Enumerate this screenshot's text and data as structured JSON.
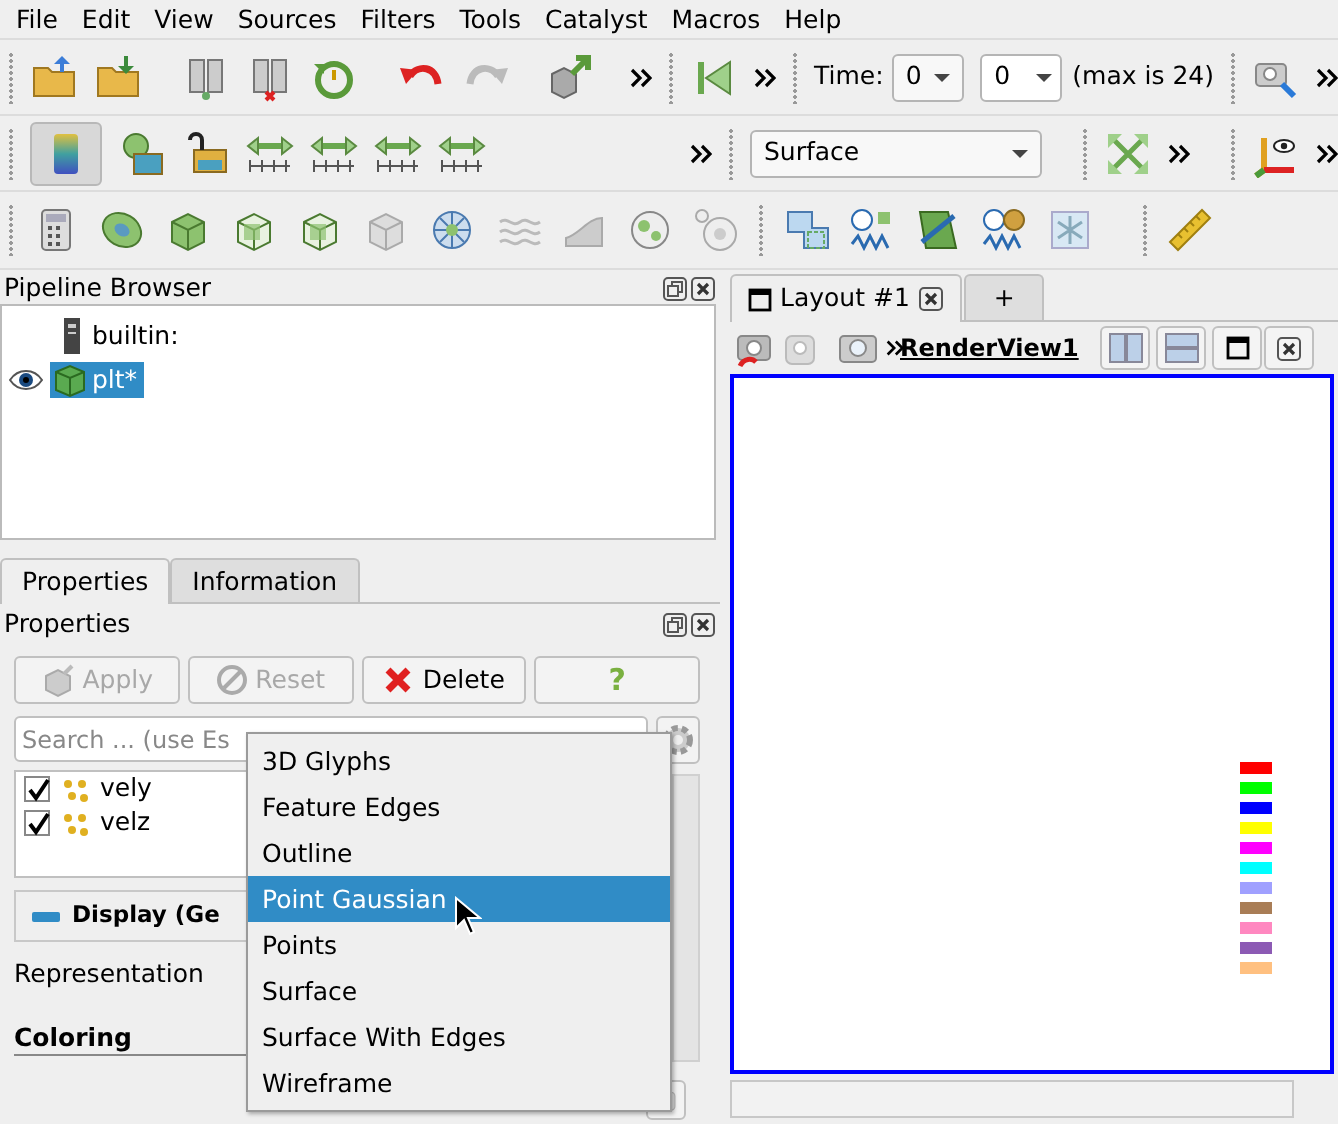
{
  "menu": [
    "File",
    "Edit",
    "View",
    "Sources",
    "Filters",
    "Tools",
    "Catalyst",
    "Macros",
    "Help"
  ],
  "time_toolbar": {
    "label": "Time:",
    "time_select": "0",
    "time_index": "0",
    "max_note": "(max is 24)"
  },
  "representation_select": "Surface",
  "pipeline_browser": {
    "title": "Pipeline Browser",
    "items": [
      {
        "label": "builtin:",
        "kind": "server",
        "selected": false
      },
      {
        "label": "plt*",
        "kind": "source",
        "selected": true
      }
    ]
  },
  "panel_tabs": [
    {
      "label": "Properties",
      "selected": true
    },
    {
      "label": "Information",
      "selected": false
    }
  ],
  "properties": {
    "title": "Properties",
    "buttons": [
      {
        "label": "Apply",
        "kind": "apply",
        "disabled": true
      },
      {
        "label": "Reset",
        "kind": "reset",
        "disabled": true
      },
      {
        "label": "Delete",
        "kind": "delete",
        "disabled": false
      },
      {
        "label": "?",
        "kind": "help",
        "disabled": false
      }
    ],
    "search_placeholder": "Search ... (use Es",
    "arrays": [
      {
        "label": "vely",
        "checked": true
      },
      {
        "label": "velz",
        "checked": true
      }
    ],
    "section": "Display (Ge",
    "representation_label": "Representation",
    "coloring_label": "Coloring"
  },
  "representation_menu": [
    {
      "label": "3D Glyphs",
      "selected": false
    },
    {
      "label": "Feature Edges",
      "selected": false
    },
    {
      "label": "Outline",
      "selected": false
    },
    {
      "label": "Point Gaussian",
      "selected": true
    },
    {
      "label": "Points",
      "selected": false
    },
    {
      "label": "Surface",
      "selected": false
    },
    {
      "label": "Surface With Edges",
      "selected": false
    },
    {
      "label": "Wireframe",
      "selected": false
    }
  ],
  "layout_tabs": [
    {
      "label": "Layout #1",
      "kind": "layout",
      "selected": true
    },
    {
      "label": "+",
      "kind": "add",
      "selected": false
    }
  ],
  "view_title": "RenderView1",
  "legend": [
    {
      "color": "#ff0000"
    },
    {
      "color": "#00ff00"
    },
    {
      "color": "#0000ff"
    },
    {
      "color": "#ffff00"
    },
    {
      "color": "#ff00ff"
    },
    {
      "color": "#00ffff"
    },
    {
      "color": "#a0a0ff"
    },
    {
      "color": "#a97d56"
    },
    {
      "color": "#ff88c0"
    },
    {
      "color": "#8c5ab4"
    },
    {
      "color": "#ffc080"
    }
  ]
}
